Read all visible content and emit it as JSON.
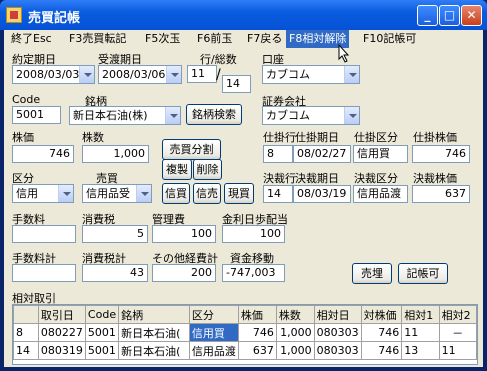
{
  "window": {
    "title": "売買記帳"
  },
  "menu": [
    "終了Esc",
    "F3売買転記",
    "F5次玉",
    "F6前玉",
    "F7戻る",
    "F8相対解除",
    "F10記帳可"
  ],
  "labels": {
    "kakutei": "約定期日",
    "ukewatashi": "受渡期日",
    "gyo": "行/総数",
    "koza": "口座",
    "code": "Code",
    "meigara": "銘柄",
    "shoken": "証券会社",
    "kabuka": "株価",
    "kabusu": "株数",
    "shikake_gyo": "仕掛行",
    "shikake_kijitsu": "仕掛期日",
    "shikake_kubun": "仕掛区分",
    "shikake_kabuka": "仕掛株価",
    "kubun": "区分",
    "baibai": "売買",
    "kessai_gyo": "決裁行",
    "kessai_kijitsu": "決裁期日",
    "kessai_kubun": "決裁区分",
    "kessai_kabuka": "決裁株価",
    "tesuryo": "手数料",
    "shohizei": "消費税",
    "kanrihi": "管理費",
    "kinri": "金利日歩配当",
    "tesuryokei": "手数料計",
    "shohizeikei": "消費税計",
    "sonota": "その他経費計",
    "shikin": "資金移動",
    "sotai": "相対取引"
  },
  "fields": {
    "kakutei": "2008/03/03",
    "ukewatashi": "2008/03/06",
    "gyo": "11",
    "sosu": "14",
    "koza": "カブコム",
    "code": "5001",
    "meigara": "新日本石油(株)",
    "shoken": "カブコム",
    "kabuka": "746",
    "kabusu": "1,000",
    "shikake_gyo": "8",
    "shikake_kijitsu": "08/02/27",
    "shikake_kubun": "信用買",
    "shikake_kabuka": "746",
    "kubun": "信用",
    "baibai": "信用品受",
    "kessai_gyo": "14",
    "kessai_kijitsu": "08/03/19",
    "kessai_kubun": "信用品渡",
    "kessai_kabuka": "637",
    "tesuryo": "",
    "shohizei": "5",
    "kanrihi": "100",
    "kinri": "100",
    "tesuryokei": "",
    "shohizeikei": "43",
    "sonota": "200",
    "shikin": "-747,003"
  },
  "buttons": {
    "meigara_kensaku": "銘柄検索",
    "baibai_bunkatsu": "売買分割",
    "fukusei": "複製",
    "sakujo": "削除",
    "shingai": "信買",
    "shinbai": "信売",
    "genkai": "現買",
    "baiyou": "売埋",
    "kicho": "記帳可"
  },
  "table": {
    "headers": [
      "",
      "取引日",
      "Code",
      "銘柄",
      "区分",
      "株価",
      "株数",
      "相対日",
      "対株価",
      "相対1",
      "相対2"
    ],
    "rows": [
      [
        "8",
        "080227",
        "5001",
        "新日本石油(",
        "信用買",
        "746",
        "1,000",
        "080303",
        "746",
        "11",
        "－"
      ],
      [
        "14",
        "080319",
        "5001",
        "新日本石油(",
        "信用品渡",
        "637",
        "1,000",
        "080303",
        "746",
        "13",
        "11"
      ]
    ]
  }
}
